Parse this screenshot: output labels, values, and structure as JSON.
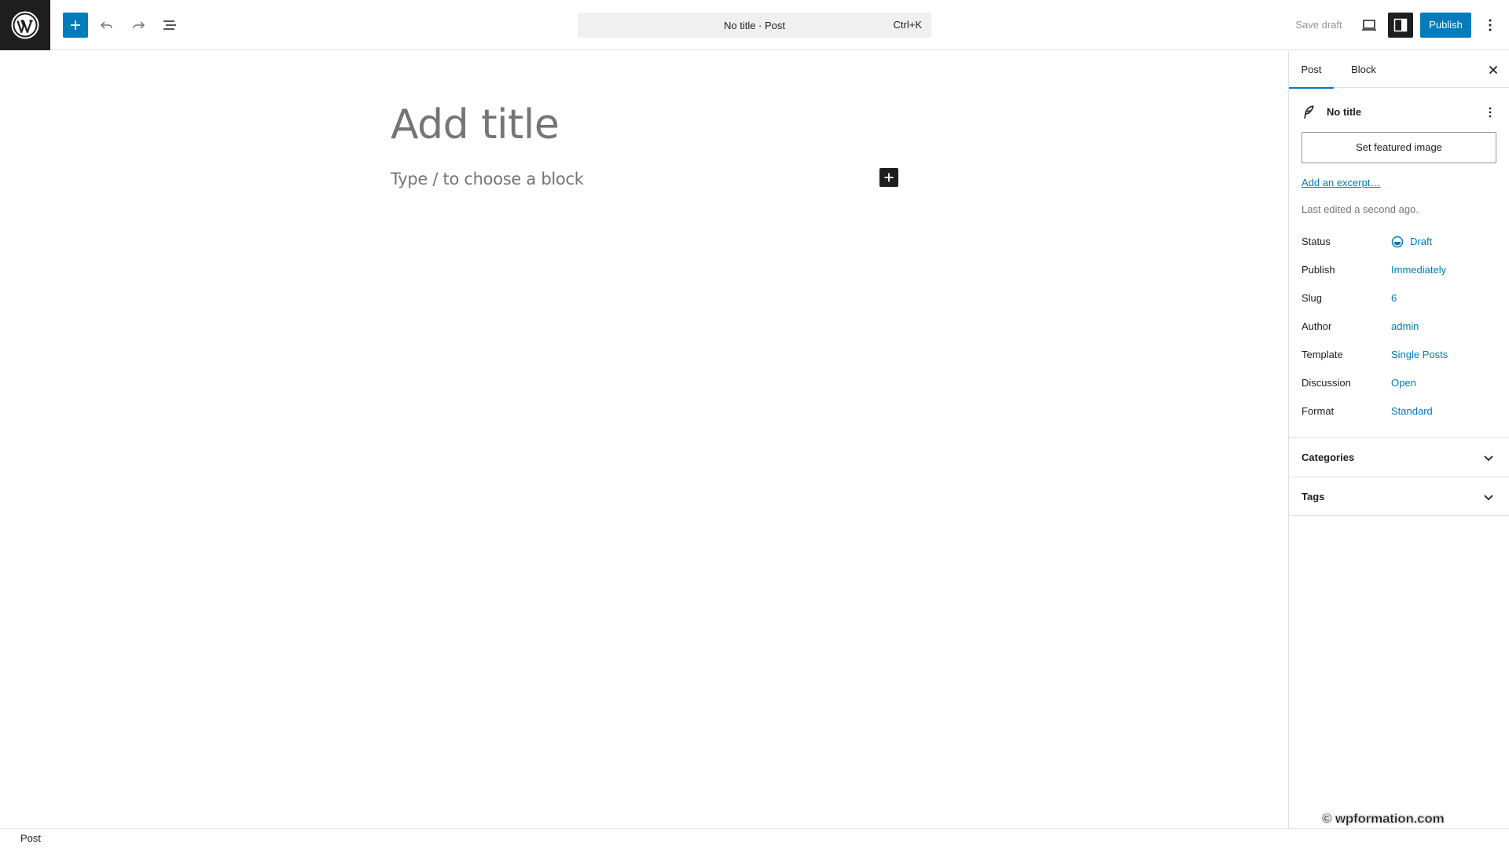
{
  "header": {
    "command_bar": {
      "title": "No title · Post",
      "shortcut": "Ctrl+K"
    },
    "save_draft_label": "Save draft",
    "publish_label": "Publish"
  },
  "editor": {
    "title_placeholder": "Add title",
    "block_placeholder": "Type / to choose a block"
  },
  "sidebar": {
    "tabs": [
      {
        "label": "Post"
      },
      {
        "label": "Block"
      }
    ],
    "post_title": "No title",
    "featured_image_label": "Set featured image",
    "excerpt_link": "Add an excerpt…",
    "last_edited": "Last edited a second ago.",
    "meta": [
      {
        "label": "Status",
        "value": "Draft"
      },
      {
        "label": "Publish",
        "value": "Immediately"
      },
      {
        "label": "Slug",
        "value": "6"
      },
      {
        "label": "Author",
        "value": "admin"
      },
      {
        "label": "Template",
        "value": "Single Posts"
      },
      {
        "label": "Discussion",
        "value": "Open"
      },
      {
        "label": "Format",
        "value": "Standard"
      }
    ],
    "panels": [
      {
        "title": "Categories"
      },
      {
        "title": "Tags"
      }
    ]
  },
  "footer": {
    "breadcrumb": "Post"
  },
  "watermark": "© wpformation.com",
  "colors": {
    "accent": "#007cba",
    "dark": "#1e1e1e",
    "muted": "#757575",
    "border": "#e0e0e0"
  },
  "icons": [
    "wordpress-logo",
    "plus-icon",
    "undo-icon",
    "redo-icon",
    "list-view-icon",
    "desktop-icon",
    "sidebar-icon",
    "more-vertical-icon",
    "close-icon",
    "feather-icon",
    "draft-status-icon",
    "chevron-down-icon"
  ]
}
